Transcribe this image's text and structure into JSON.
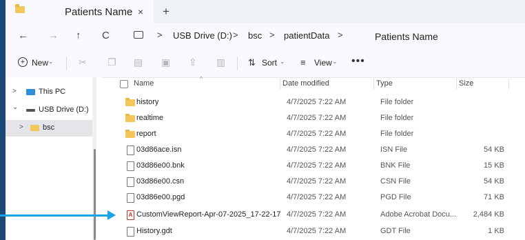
{
  "tab": {
    "title": "Patients Name",
    "close": "×",
    "new": "+"
  },
  "nav": {
    "back": "←",
    "forward": "→",
    "up": "↑",
    "refresh": "C",
    "sep": ">",
    "crumbs": [
      "USB Drive (D:)",
      "bsc",
      "patientData"
    ],
    "search_text": "Patients Name"
  },
  "toolbar": {
    "new_label": "New",
    "sort_label": "Sort",
    "view_label": "View",
    "more": "•••"
  },
  "sidebar": {
    "items": [
      {
        "label": "This PC",
        "chevron": ">"
      },
      {
        "label": "USB Drive (D:)",
        "chevron": "⌄"
      },
      {
        "label": "bsc",
        "chevron": ">"
      }
    ]
  },
  "columns": {
    "name": "Name",
    "date": "Date modified",
    "type": "Type",
    "size": "Size"
  },
  "files": [
    {
      "name": "history",
      "date": "4/7/2025 7:22 AM",
      "type": "File folder",
      "size": "",
      "kind": "folder"
    },
    {
      "name": "realtime",
      "date": "4/7/2025 7:22 AM",
      "type": "File folder",
      "size": "",
      "kind": "folder"
    },
    {
      "name": "report",
      "date": "4/7/2025 7:22 AM",
      "type": "File folder",
      "size": "",
      "kind": "folder"
    },
    {
      "name": "03d86ace.isn",
      "date": "4/7/2025 7:22 AM",
      "type": "ISN File",
      "size": "54 KB",
      "kind": "file"
    },
    {
      "name": "03d86e00.bnk",
      "date": "4/7/2025 7:22 AM",
      "type": "BNK File",
      "size": "15 KB",
      "kind": "file"
    },
    {
      "name": "03d86e00.csn",
      "date": "4/7/2025 7:22 AM",
      "type": "CSN File",
      "size": "54 KB",
      "kind": "file"
    },
    {
      "name": "03d86e00.pgd",
      "date": "4/7/2025 7:22 AM",
      "type": "PGD File",
      "size": "71 KB",
      "kind": "file"
    },
    {
      "name": "CustomViewReport-Apr-07-2025_17-22-17",
      "date": "4/7/2025 7:22 AM",
      "type": "Adobe Acrobat Docu...",
      "size": "2,484 KB",
      "kind": "pdf"
    },
    {
      "name": "History.gdt",
      "date": "4/7/2025 7:22 AM",
      "type": "GDT File",
      "size": "1 KB",
      "kind": "file"
    }
  ],
  "colors": {
    "accent_arrow": "#1aa3e8",
    "folder": "#f2c75c",
    "backdrop": "#1b4a78"
  }
}
